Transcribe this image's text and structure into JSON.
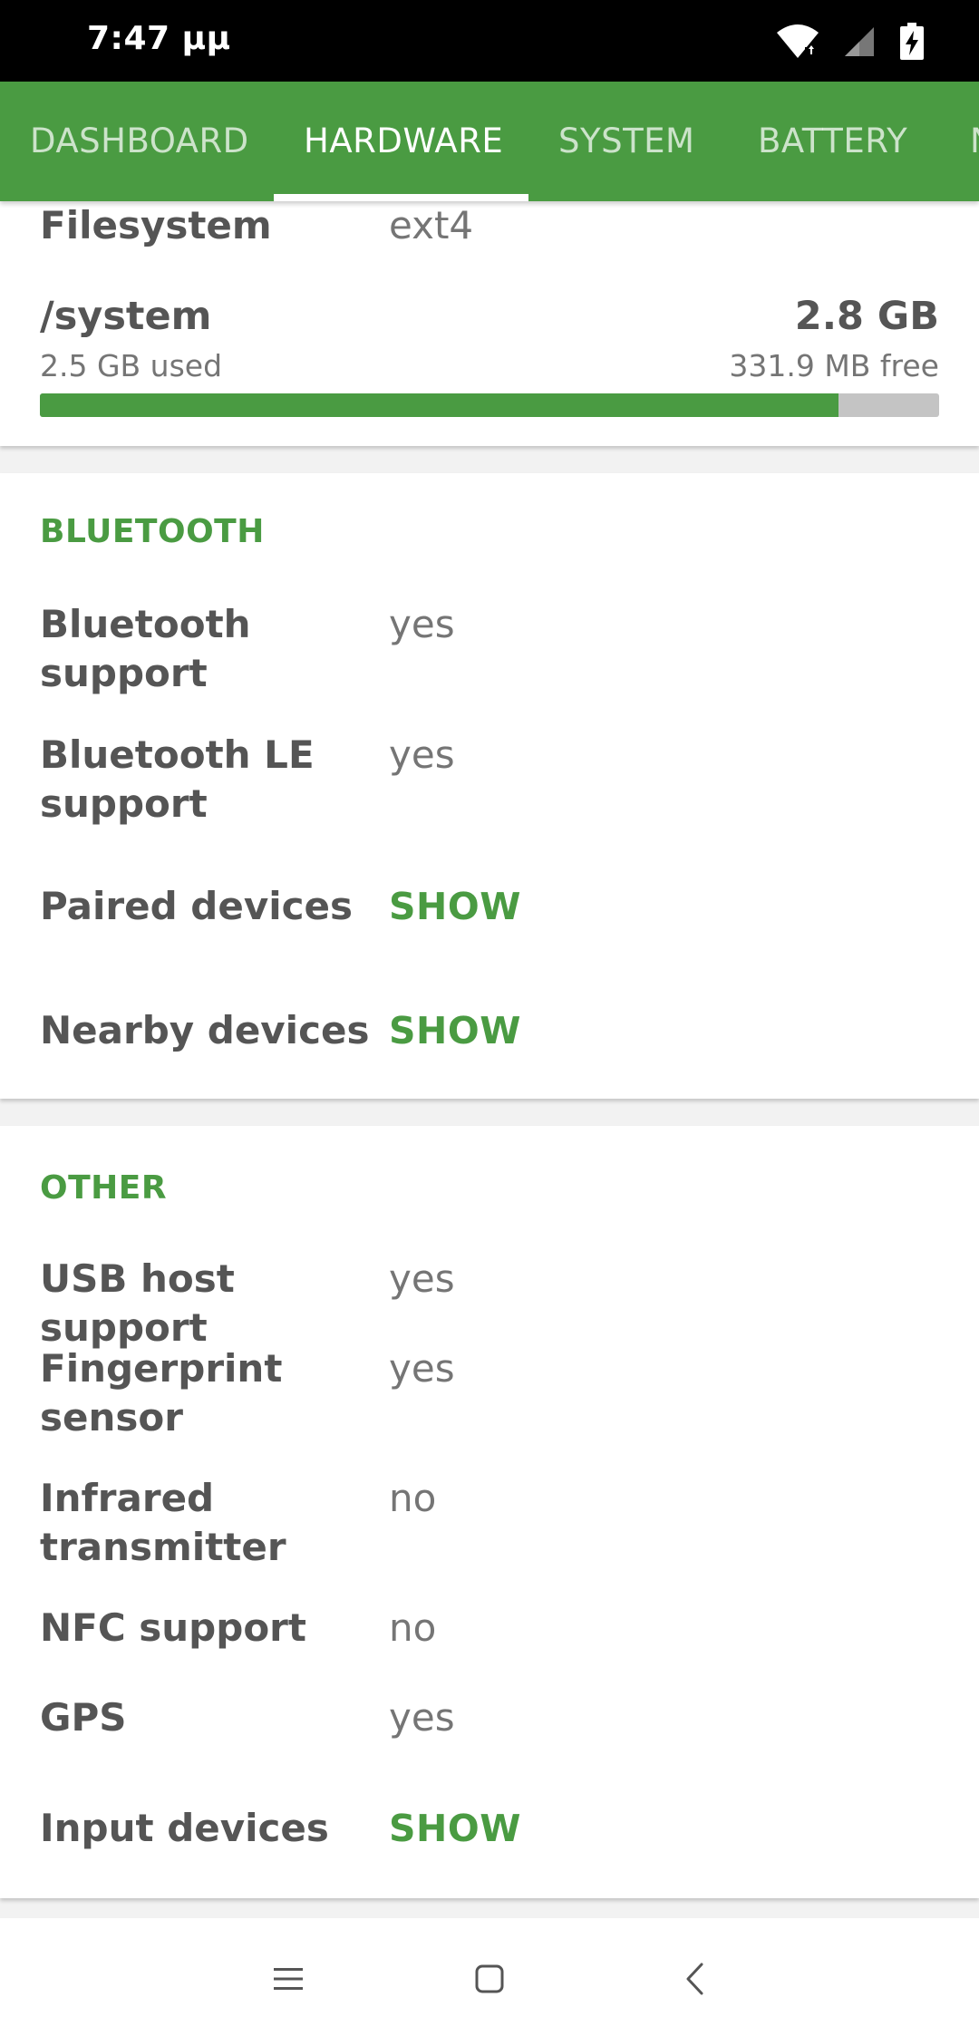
{
  "status_bar": {
    "time": "7:47 μμ",
    "icons": [
      "wifi-icon",
      "cell-signal-icon",
      "battery-charging-icon"
    ]
  },
  "tabs": [
    {
      "label": "DASHBOARD",
      "active": false
    },
    {
      "label": "HARDWARE",
      "active": true
    },
    {
      "label": "SYSTEM",
      "active": false
    },
    {
      "label": "BATTERY",
      "active": false
    },
    {
      "label": "N",
      "active": false
    }
  ],
  "storage_card": {
    "filesystem_label": "Filesystem",
    "filesystem_value": "ext4",
    "partition_name": "/system",
    "total": "2.8 GB",
    "used": "2.5 GB used",
    "free": "331.9 MB free",
    "used_fraction": 0.888
  },
  "bluetooth": {
    "header": "BLUETOOTH",
    "rows": [
      {
        "label": "Bluetooth support",
        "value": "yes"
      },
      {
        "label": "Bluetooth LE support",
        "value": "yes"
      },
      {
        "label": "Paired devices",
        "value": "SHOW"
      },
      {
        "label": "Nearby devices",
        "value": "SHOW"
      }
    ]
  },
  "other": {
    "header": "OTHER",
    "rows": [
      {
        "label": "USB host support",
        "value": "yes"
      },
      {
        "label": "Fingerprint sensor",
        "value": "yes"
      },
      {
        "label": "Infrared transmitter",
        "value": "no"
      },
      {
        "label": "NFC support",
        "value": "no"
      },
      {
        "label": "GPS",
        "value": "yes"
      },
      {
        "label": "Input devices",
        "value": "SHOW"
      }
    ]
  },
  "nav_bar": {
    "buttons": [
      "menu-icon",
      "home-icon",
      "back-icon"
    ]
  },
  "colors": {
    "accent": "#4a9b42",
    "label": "#555555",
    "value": "#757575"
  }
}
